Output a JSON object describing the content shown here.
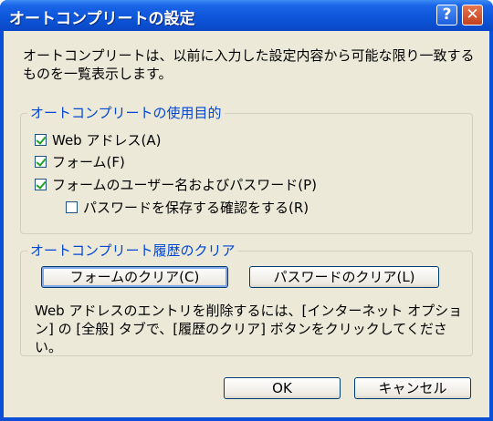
{
  "window": {
    "title": "オートコンプリートの設定",
    "help_glyph": "?",
    "close_glyph": "✕"
  },
  "description": "オートコンプリートは、以前に入力した設定内容から可能な限り一致するものを一覧表示します。",
  "usage_group": {
    "legend": "オートコンプリートの使用目的",
    "options": [
      {
        "label": "Web アドレス(A)",
        "checked": true
      },
      {
        "label": "フォーム(F)",
        "checked": true
      },
      {
        "label": "フォームのユーザー名およびパスワード(P)",
        "checked": true
      },
      {
        "label": "パスワードを保存する確認をする(R)",
        "checked": false
      }
    ]
  },
  "history_group": {
    "legend": "オートコンプリート履歴のクリア",
    "clear_forms_label": "フォームのクリア(C)",
    "clear_passwords_label": "パスワードのクリア(L)",
    "help_text": "Web アドレスのエントリを削除するには、[インターネット オプション] の [全般] タブで、[履歴のクリア] ボタンをクリックしてください。"
  },
  "footer": {
    "ok_label": "OK",
    "cancel_label": "キャンセル"
  },
  "colors": {
    "titlebar": "#0a4fd6",
    "dialog_bg": "#ece9d8",
    "group_legend": "#0046d5",
    "checkmark": "#21a121"
  }
}
